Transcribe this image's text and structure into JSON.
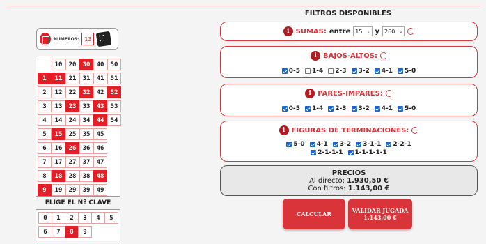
{
  "numeros": {
    "label": "NUMEROS:",
    "count": "13"
  },
  "grid": {
    "cells": [
      {
        "v": "10",
        "c": 1,
        "r": 0,
        "s": false
      },
      {
        "v": "20",
        "c": 2,
        "r": 0,
        "s": false
      },
      {
        "v": "30",
        "c": 3,
        "r": 0,
        "s": true
      },
      {
        "v": "40",
        "c": 4,
        "r": 0,
        "s": false
      },
      {
        "v": "50",
        "c": 5,
        "r": 0,
        "s": false
      },
      {
        "v": "1",
        "c": 0,
        "r": 1,
        "s": true
      },
      {
        "v": "11",
        "c": 1,
        "r": 1,
        "s": true
      },
      {
        "v": "21",
        "c": 2,
        "r": 1,
        "s": false
      },
      {
        "v": "31",
        "c": 3,
        "r": 1,
        "s": false
      },
      {
        "v": "41",
        "c": 4,
        "r": 1,
        "s": false
      },
      {
        "v": "51",
        "c": 5,
        "r": 1,
        "s": false
      },
      {
        "v": "2",
        "c": 0,
        "r": 2,
        "s": false
      },
      {
        "v": "12",
        "c": 1,
        "r": 2,
        "s": false
      },
      {
        "v": "22",
        "c": 2,
        "r": 2,
        "s": false
      },
      {
        "v": "32",
        "c": 3,
        "r": 2,
        "s": true
      },
      {
        "v": "42",
        "c": 4,
        "r": 2,
        "s": false
      },
      {
        "v": "52",
        "c": 5,
        "r": 2,
        "s": true
      },
      {
        "v": "3",
        "c": 0,
        "r": 3,
        "s": false
      },
      {
        "v": "13",
        "c": 1,
        "r": 3,
        "s": false
      },
      {
        "v": "23",
        "c": 2,
        "r": 3,
        "s": true
      },
      {
        "v": "33",
        "c": 3,
        "r": 3,
        "s": false
      },
      {
        "v": "43",
        "c": 4,
        "r": 3,
        "s": true
      },
      {
        "v": "53",
        "c": 5,
        "r": 3,
        "s": false
      },
      {
        "v": "4",
        "c": 0,
        "r": 4,
        "s": false
      },
      {
        "v": "14",
        "c": 1,
        "r": 4,
        "s": false
      },
      {
        "v": "24",
        "c": 2,
        "r": 4,
        "s": false
      },
      {
        "v": "34",
        "c": 3,
        "r": 4,
        "s": false
      },
      {
        "v": "44",
        "c": 4,
        "r": 4,
        "s": true
      },
      {
        "v": "54",
        "c": 5,
        "r": 4,
        "s": false
      },
      {
        "v": "5",
        "c": 0,
        "r": 5,
        "s": false
      },
      {
        "v": "15",
        "c": 1,
        "r": 5,
        "s": true
      },
      {
        "v": "25",
        "c": 2,
        "r": 5,
        "s": false
      },
      {
        "v": "35",
        "c": 3,
        "r": 5,
        "s": false
      },
      {
        "v": "45",
        "c": 4,
        "r": 5,
        "s": false
      },
      {
        "v": "6",
        "c": 0,
        "r": 6,
        "s": false
      },
      {
        "v": "16",
        "c": 1,
        "r": 6,
        "s": false
      },
      {
        "v": "26",
        "c": 2,
        "r": 6,
        "s": true
      },
      {
        "v": "36",
        "c": 3,
        "r": 6,
        "s": false
      },
      {
        "v": "46",
        "c": 4,
        "r": 6,
        "s": false
      },
      {
        "v": "7",
        "c": 0,
        "r": 7,
        "s": false
      },
      {
        "v": "17",
        "c": 1,
        "r": 7,
        "s": false
      },
      {
        "v": "27",
        "c": 2,
        "r": 7,
        "s": false
      },
      {
        "v": "37",
        "c": 3,
        "r": 7,
        "s": false
      },
      {
        "v": "47",
        "c": 4,
        "r": 7,
        "s": false
      },
      {
        "v": "8",
        "c": 0,
        "r": 8,
        "s": false
      },
      {
        "v": "18",
        "c": 1,
        "r": 8,
        "s": true
      },
      {
        "v": "28",
        "c": 2,
        "r": 8,
        "s": false
      },
      {
        "v": "38",
        "c": 3,
        "r": 8,
        "s": false
      },
      {
        "v": "48",
        "c": 4,
        "r": 8,
        "s": true
      },
      {
        "v": "9",
        "c": 0,
        "r": 9,
        "s": true
      },
      {
        "v": "19",
        "c": 1,
        "r": 9,
        "s": false
      },
      {
        "v": "29",
        "c": 2,
        "r": 9,
        "s": false
      },
      {
        "v": "39",
        "c": 3,
        "r": 9,
        "s": false
      },
      {
        "v": "49",
        "c": 4,
        "r": 9,
        "s": false
      }
    ]
  },
  "clave": {
    "title": "ELIGE EL Nº CLAVE",
    "cells": [
      {
        "v": "0",
        "c": 0,
        "r": 0,
        "s": false
      },
      {
        "v": "1",
        "c": 1,
        "r": 0,
        "s": false
      },
      {
        "v": "2",
        "c": 2,
        "r": 0,
        "s": false
      },
      {
        "v": "3",
        "c": 3,
        "r": 0,
        "s": false
      },
      {
        "v": "4",
        "c": 4,
        "r": 0,
        "s": false
      },
      {
        "v": "5",
        "c": 5,
        "r": 0,
        "s": false
      },
      {
        "v": "6",
        "c": 0,
        "r": 1,
        "s": false
      },
      {
        "v": "7",
        "c": 1,
        "r": 1,
        "s": false
      },
      {
        "v": "8",
        "c": 2,
        "r": 1,
        "s": true
      },
      {
        "v": "9",
        "c": 3,
        "r": 1,
        "s": false
      }
    ]
  },
  "filters": {
    "title": "FILTROS DISPONIBLES",
    "sumas": {
      "label": "SUMAS:",
      "entre": "entre",
      "from": "15",
      "y": "y",
      "to": "260"
    },
    "bajos_altos": {
      "label": "BAJOS-ALTOS:",
      "options": [
        {
          "label": "0-5",
          "checked": true
        },
        {
          "label": "1-4",
          "checked": false
        },
        {
          "label": "2-3",
          "checked": false
        },
        {
          "label": "3-2",
          "checked": true
        },
        {
          "label": "4-1",
          "checked": true
        },
        {
          "label": "5-0",
          "checked": true
        }
      ]
    },
    "pares_impares": {
      "label": "PARES-IMPARES:",
      "options": [
        {
          "label": "0-5",
          "checked": true
        },
        {
          "label": "1-4",
          "checked": true
        },
        {
          "label": "2-3",
          "checked": true
        },
        {
          "label": "3-2",
          "checked": true
        },
        {
          "label": "4-1",
          "checked": true
        },
        {
          "label": "5-0",
          "checked": true
        }
      ]
    },
    "figuras": {
      "label": "FIGURAS DE TERMINACIONES:",
      "options": [
        {
          "label": "5-0",
          "checked": true
        },
        {
          "label": "4-1",
          "checked": true
        },
        {
          "label": "3-2",
          "checked": true
        },
        {
          "label": "3-1-1",
          "checked": true
        },
        {
          "label": "2-2-1",
          "checked": true
        },
        {
          "label": "2-1-1-1",
          "checked": true
        },
        {
          "label": "1-1-1-1-1",
          "checked": true
        }
      ]
    }
  },
  "precios": {
    "title": "PRECIOS",
    "directo_label": "Al directo:",
    "directo_value": "1.930,50 €",
    "filtros_label": "Con filtros:",
    "filtros_value": "1.143,00 €"
  },
  "buttons": {
    "calcular": "CALCULAR",
    "validar": "VALIDAR JUGADA",
    "validar_amount": "1.143,00 €"
  },
  "colors": {
    "accent": "#e21f26",
    "checkbox": "#1a66d1"
  }
}
